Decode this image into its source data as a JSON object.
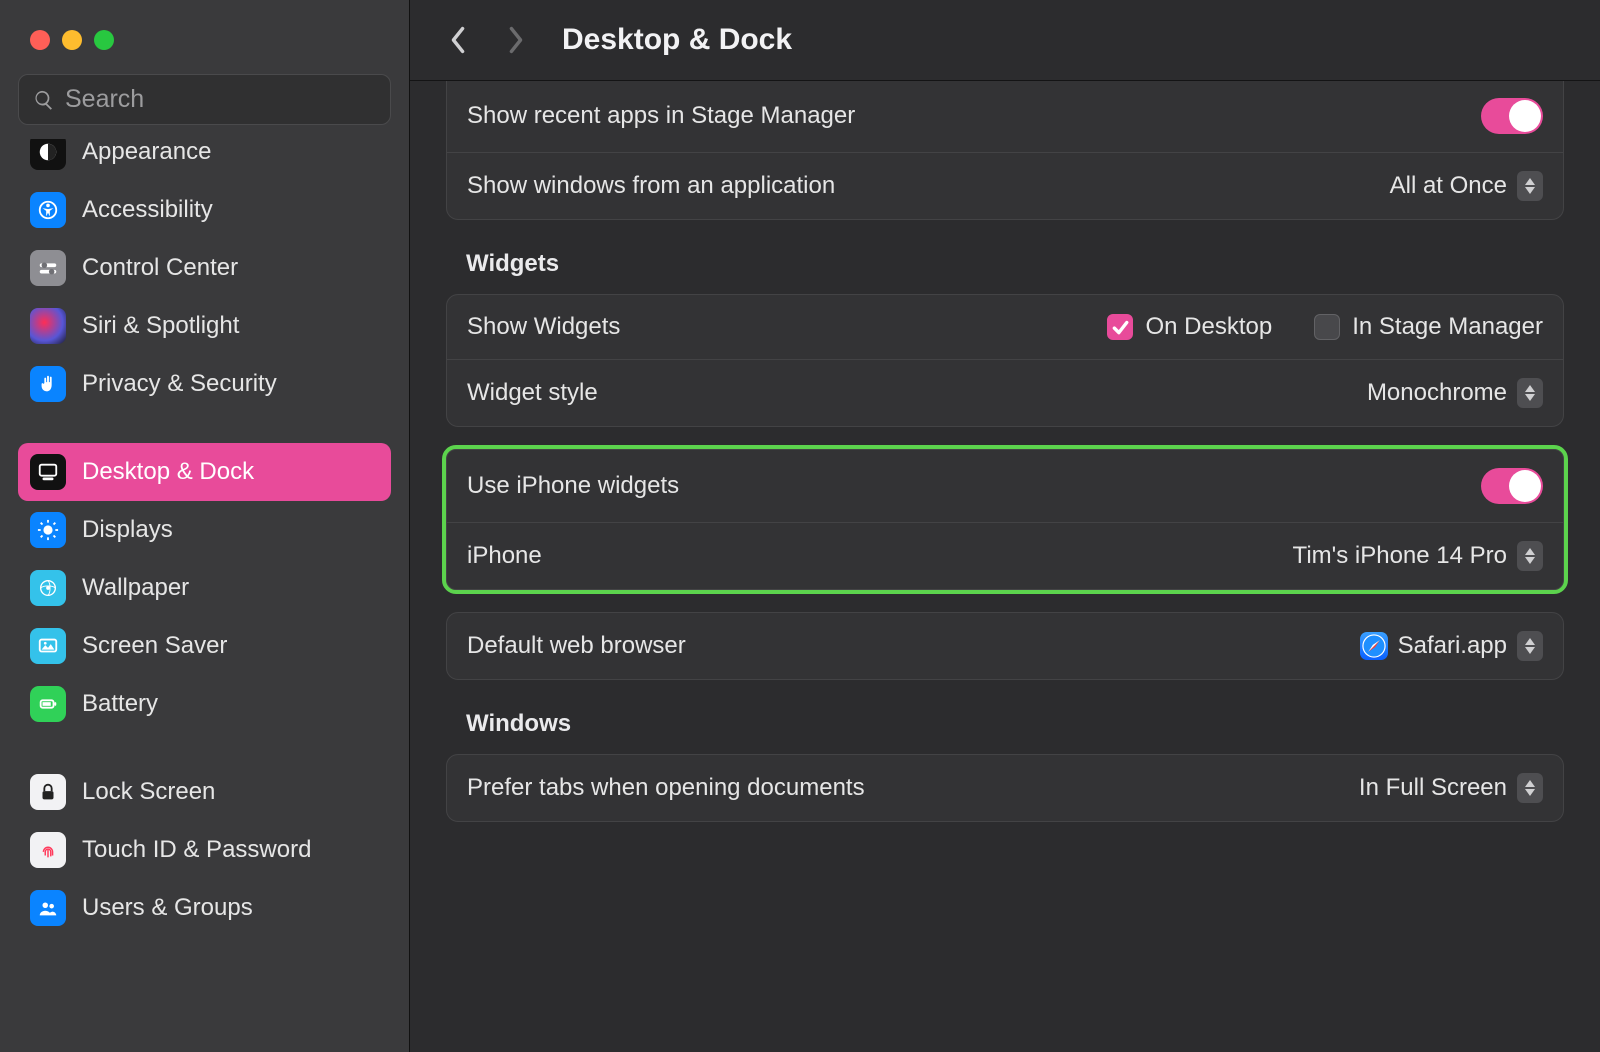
{
  "search": {
    "placeholder": "Search"
  },
  "sidebar": {
    "items": [
      {
        "label": "Appearance"
      },
      {
        "label": "Accessibility"
      },
      {
        "label": "Control Center"
      },
      {
        "label": "Siri & Spotlight"
      },
      {
        "label": "Privacy & Security"
      },
      {
        "label": "Desktop & Dock"
      },
      {
        "label": "Displays"
      },
      {
        "label": "Wallpaper"
      },
      {
        "label": "Screen Saver"
      },
      {
        "label": "Battery"
      },
      {
        "label": "Lock Screen"
      },
      {
        "label": "Touch ID & Password"
      },
      {
        "label": "Users & Groups"
      }
    ]
  },
  "header": {
    "title": "Desktop & Dock"
  },
  "topCard": {
    "recentApps": "Show recent apps in Stage Manager",
    "windows": "Show windows from an application",
    "windowsValue": "All at Once"
  },
  "widgets": {
    "section": "Widgets",
    "showWidgets": "Show Widgets",
    "onDesktop": "On Desktop",
    "inStage": "In Stage Manager",
    "styleLabel": "Widget style",
    "styleValue": "Monochrome",
    "useIphone": "Use iPhone widgets",
    "iphoneLabel": "iPhone",
    "iphoneValue": "Tim's iPhone 14 Pro"
  },
  "browser": {
    "label": "Default web browser",
    "value": "Safari.app"
  },
  "windows": {
    "section": "Windows",
    "preferTabs": "Prefer tabs when opening documents",
    "preferTabsValue": "In Full Screen"
  }
}
